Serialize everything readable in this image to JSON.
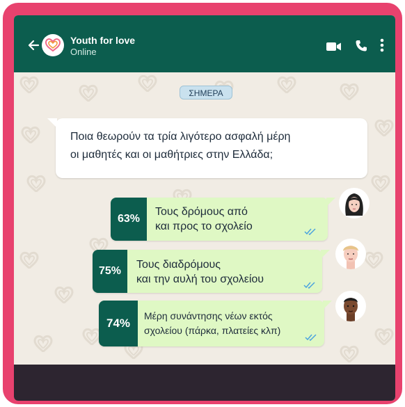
{
  "header": {
    "title": "Youth for love",
    "status": "Online",
    "back_icon": "back-arrow-icon",
    "video_icon": "video-call-icon",
    "call_icon": "phone-icon",
    "menu_icon": "more-vertical-icon"
  },
  "date_badge": "ΣΗΜΕΡΑ",
  "question": {
    "line1": "Ποια θεωρούν τα τρία λιγότερο ασφαλή μέρη",
    "line2": "οι μαθητές και οι μαθήτριες στην Ελλάδα;"
  },
  "answers": [
    {
      "percent": "63%",
      "value": 63,
      "line1": "Τους δρόμους από",
      "line2": "και προς το σχολείο"
    },
    {
      "percent": "75%",
      "value": 75,
      "line1": "Τους διαδρόμους",
      "line2": "και την αυλή του σχολείου"
    },
    {
      "percent": "74%",
      "value": 74,
      "line1": "Μέρη συνάντησης νέων εκτός",
      "line2": "σχολείου (πάρκα, πλατείες κλπ)"
    }
  ],
  "colors": {
    "frame": "#e8426e",
    "header": "#0c5d4e",
    "answer_bubble": "#dff8c4",
    "chat_bg": "#f1ece4",
    "read_ticks": "#4aa3df"
  }
}
